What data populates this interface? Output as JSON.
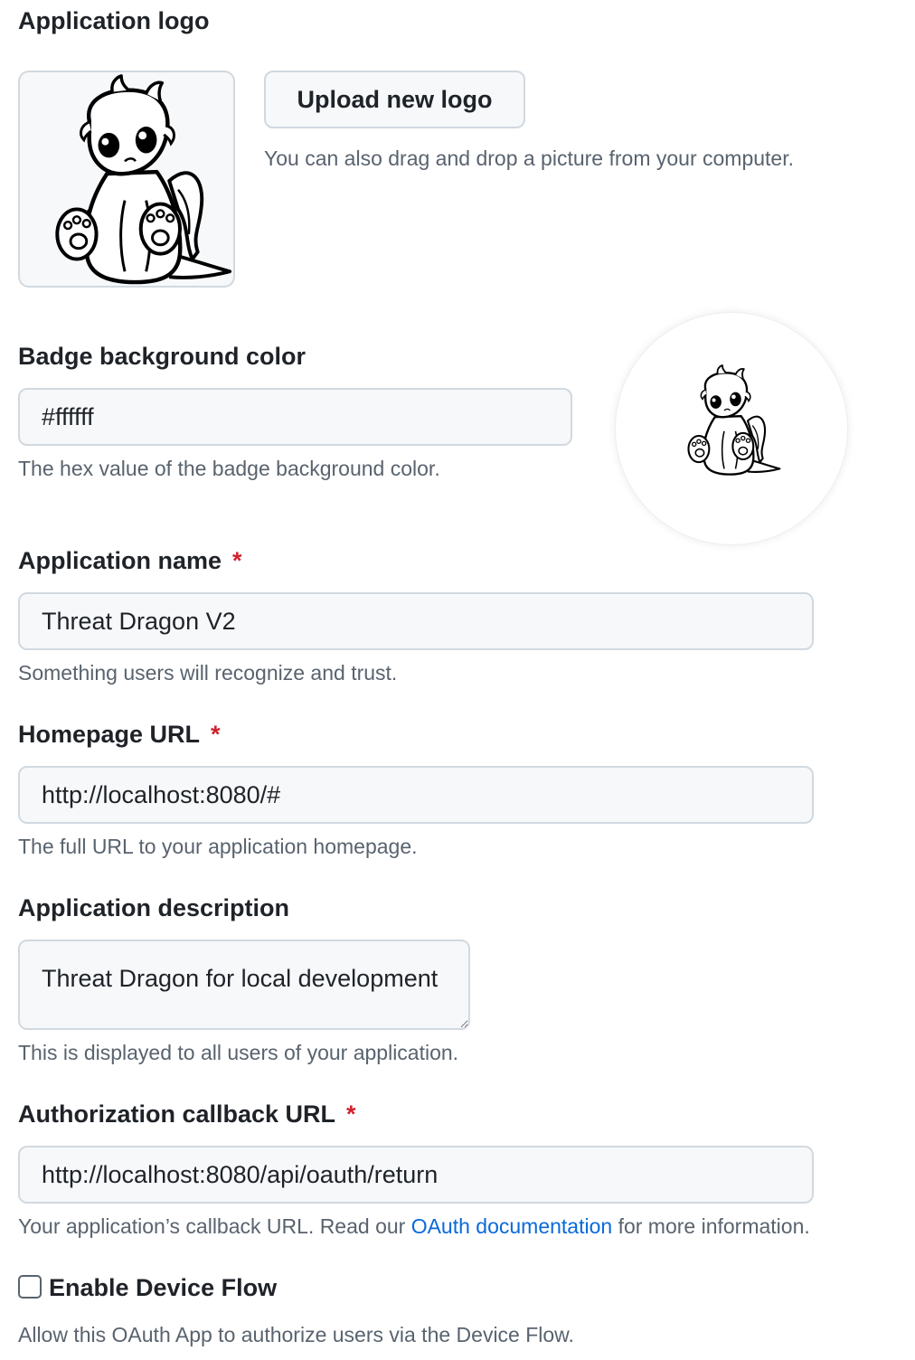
{
  "logo_section": {
    "label": "Application logo",
    "upload_button": "Upload new logo",
    "drag_hint": "You can also drag and drop a picture from your computer.",
    "logo_image": "dragon-mascot-icon"
  },
  "badge_color": {
    "label": "Badge background color",
    "value": "#ffffff",
    "hint": "The hex value of the badge background color.",
    "badge_image": "dragon-mascot-icon"
  },
  "app_name": {
    "label": "Application name",
    "required_mark": "*",
    "value": "Threat Dragon V2",
    "hint": "Something users will recognize and trust."
  },
  "homepage_url": {
    "label": "Homepage URL",
    "required_mark": "*",
    "value": "http://localhost:8080/#",
    "hint": "The full URL to your application homepage."
  },
  "description": {
    "label": "Application description",
    "value": "Threat Dragon for local development",
    "hint": "This is displayed to all users of your application."
  },
  "callback_url": {
    "label": "Authorization callback URL",
    "required_mark": "*",
    "value": "http://localhost:8080/api/oauth/return",
    "hint_before": "Your application’s callback URL. Read our ",
    "hint_link": "OAuth documentation",
    "hint_after": " for more information."
  },
  "device_flow": {
    "label": "Enable Device Flow",
    "checked": false,
    "hint": "Allow this OAuth App to authorize users via the Device Flow."
  },
  "colors": {
    "required": "#cf222e",
    "link": "#0969da",
    "input_background": "#f6f8fa",
    "border": "#d1d9e0",
    "muted_text": "#59636e"
  }
}
